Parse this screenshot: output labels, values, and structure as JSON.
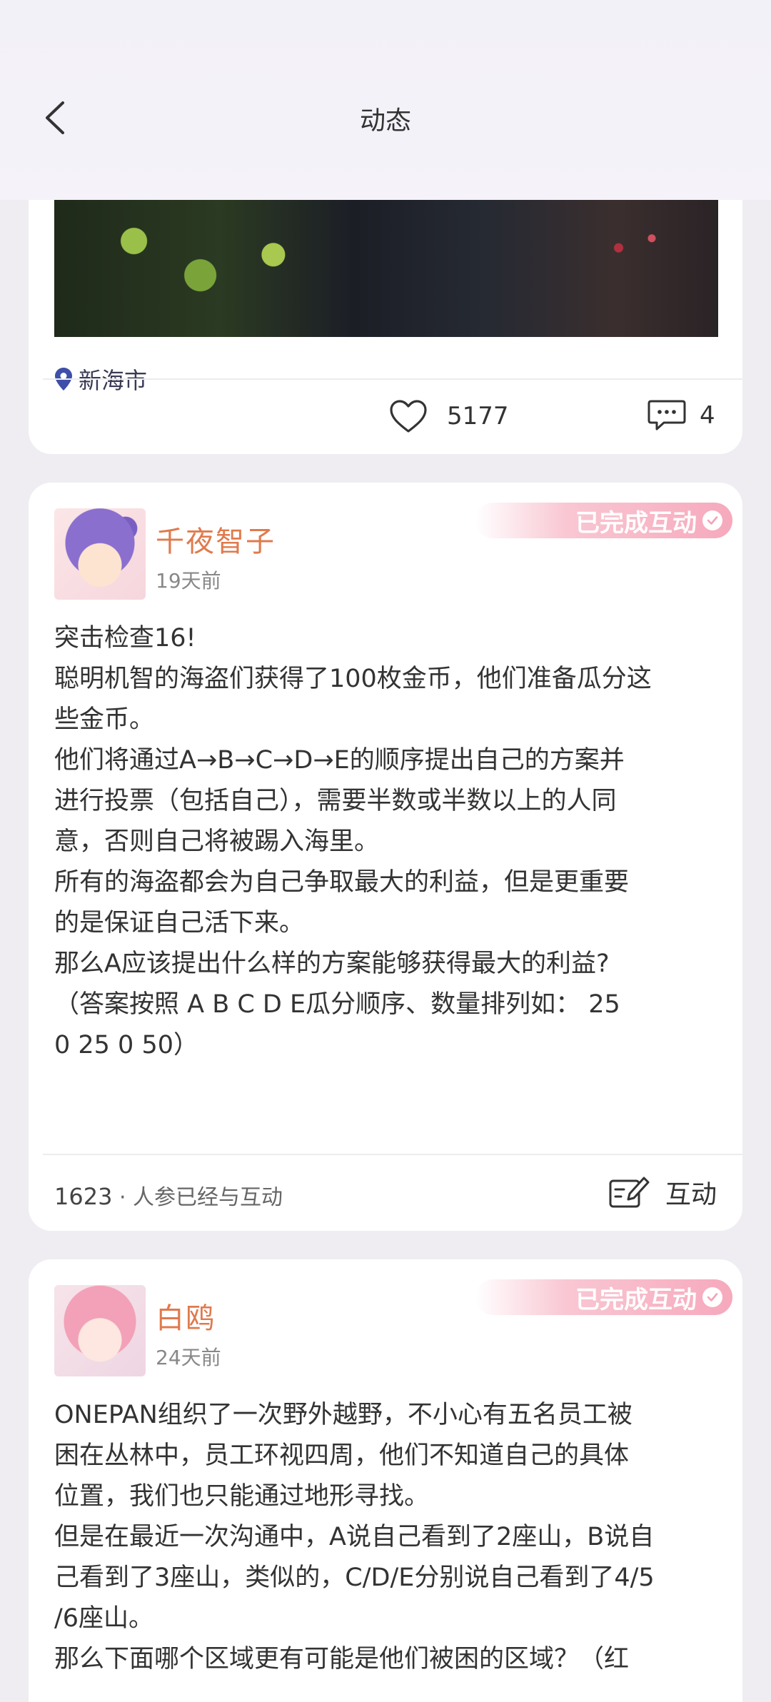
{
  "header": {
    "title": "动态"
  },
  "post0": {
    "location": "新海市",
    "likes": "5177",
    "comments": "4"
  },
  "post1": {
    "username": "千夜智子",
    "time": "19天前",
    "badge": "已完成互动",
    "lines": [
      "突击检查16!",
      "聪明机智的海盗们获得了100枚金币，他们准备瓜分这",
      "些金币。",
      "他们将通过A→B→C→D→E的顺序提出自己的方案并",
      "进行投票（包括自己），需要半数或半数以上的人同",
      "意，否则自己将被踢入海里。",
      "所有的海盗都会为自己争取最大的利益，但是更重要",
      "的是保证自己活下来。",
      "那么A应该提出什么样的方案能够获得最大的利益?",
      "（答案按照 A B C D E瓜分顺序、数量排列如： 25",
      "0 25 0 50）"
    ],
    "participants": "1623",
    "participants_label": " · 人参已经与互动",
    "interact_label": "互动"
  },
  "post2": {
    "username": "白鸥",
    "time": "24天前",
    "badge": "已完成互动",
    "lines": [
      "ONEPAN组织了一次野外越野，不小心有五名员工被",
      "困在丛林中，员工环视四周，他们不知道自己的具体",
      "位置，我们也只能通过地形寻找。",
      "但是在最近一次沟通中，A说自己看到了2座山，B说自",
      "己看到了3座山，类似的，C/D/E分别说自己看到了4/5",
      "/6座山。",
      "那么下面哪个区域更有可能是他们被困的区域？（红"
    ]
  }
}
